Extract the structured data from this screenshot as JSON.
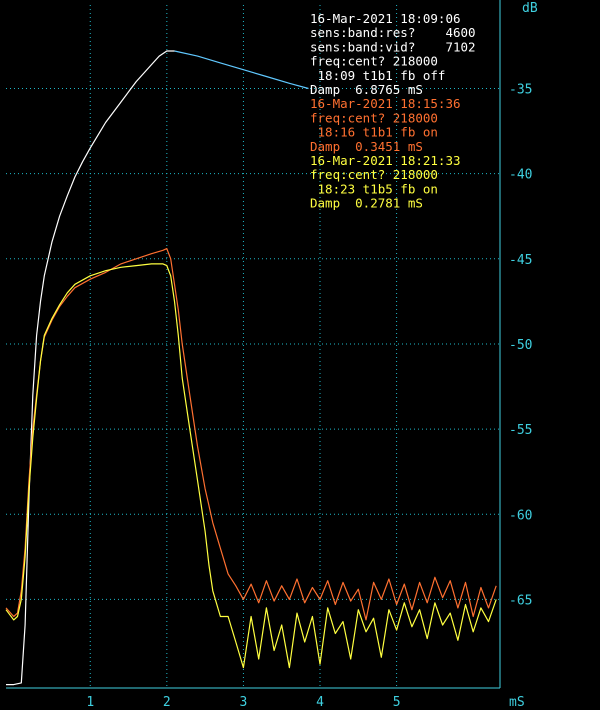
{
  "chart_data": {
    "type": "line",
    "ylabel": "dB",
    "xlabel": "mS",
    "xlim": [
      -0.1,
      6.35
    ],
    "ylim": [
      -70.2,
      -30.1
    ],
    "grid": true,
    "x_ticks": [
      1,
      2,
      3,
      4,
      5
    ],
    "y_ticks": [
      -35,
      -40,
      -45,
      -50,
      -55,
      -60,
      -65
    ],
    "annotations": [
      {
        "color": "#ffffff",
        "lines": [
          "16-Mar-2021 18:09:06",
          "sens:band:res?    4600",
          "sens:band:vid?    7102",
          "freq:cent? 218000",
          " 18:09 t1b1 fb off",
          "Damp  6.8765 mS"
        ]
      },
      {
        "color": "#ff7030",
        "lines": [
          "16-Mar-2021 18:15:36",
          "freq:cent? 218000",
          " 18:16 t1b1 fb on",
          "Damp  0.3451 mS"
        ]
      },
      {
        "color": "#ffff40",
        "lines": [
          "16-Mar-2021 18:21:33",
          "freq:cent? 218000",
          " 18:23 t1b5 fb on",
          "Damp  0.2781 mS"
        ]
      }
    ],
    "series": [
      {
        "color": "#ffffff",
        "x": [
          -0.1,
          0.0,
          0.1,
          0.15,
          0.2,
          0.25,
          0.3,
          0.35,
          0.4,
          0.5,
          0.6,
          0.7,
          0.8,
          0.9,
          1.0,
          1.2,
          1.4,
          1.6,
          1.8,
          1.9,
          2.0,
          2.1
        ],
        "y": [
          -70.0,
          -70.0,
          -69.9,
          -66.5,
          -59.0,
          -53.0,
          -49.5,
          -47.5,
          -46.0,
          -44.0,
          -42.5,
          -41.3,
          -40.2,
          -39.3,
          -38.5,
          -37.0,
          -35.8,
          -34.6,
          -33.6,
          -33.1,
          -32.8,
          -32.8
        ]
      },
      {
        "color": "#60c8ff",
        "x": [
          2.1,
          2.4,
          2.7,
          3.0,
          3.3,
          3.6,
          3.85
        ],
        "y": [
          -32.8,
          -33.1,
          -33.5,
          -33.9,
          -34.3,
          -34.7,
          -35.0
        ]
      },
      {
        "color": "#ff7030",
        "x": [
          -0.1,
          0.0,
          0.05,
          0.1,
          0.15,
          0.2,
          0.25,
          0.3,
          0.35,
          0.4,
          0.5,
          0.6,
          0.7,
          0.8,
          1.0,
          1.2,
          1.4,
          1.6,
          1.8,
          1.95,
          2.0,
          2.05,
          2.1,
          2.15,
          2.2,
          2.3,
          2.4,
          2.5,
          2.55,
          2.6,
          2.7,
          2.8,
          2.9,
          3.0,
          3.1,
          3.2,
          3.3,
          3.4,
          3.5,
          3.6,
          3.7,
          3.8,
          3.9,
          4.0,
          4.1,
          4.2,
          4.3,
          4.4,
          4.5,
          4.6,
          4.7,
          4.8,
          4.9,
          5.0,
          5.1,
          5.2,
          5.3,
          5.4,
          5.5,
          5.6,
          5.7,
          5.8,
          5.9,
          6.0,
          6.1,
          6.2,
          6.3
        ],
        "y": [
          -65.5,
          -66.0,
          -65.8,
          -64.5,
          -62.0,
          -58.0,
          -55.0,
          -53.0,
          -51.0,
          -49.6,
          -48.6,
          -47.8,
          -47.2,
          -46.7,
          -46.2,
          -45.8,
          -45.3,
          -45.0,
          -44.7,
          -44.5,
          -44.4,
          -45.0,
          -46.5,
          -48.0,
          -50.0,
          -53.0,
          -56.0,
          -58.5,
          -59.5,
          -60.5,
          -62.0,
          -63.5,
          -64.2,
          -65.0,
          -64.1,
          -65.2,
          -63.9,
          -65.1,
          -64.2,
          -65.0,
          -63.8,
          -65.2,
          -64.3,
          -65.0,
          -63.9,
          -65.3,
          -64.0,
          -65.1,
          -64.4,
          -66.2,
          -64.0,
          -65.0,
          -63.8,
          -65.3,
          -64.1,
          -65.6,
          -64.0,
          -65.2,
          -63.7,
          -64.9,
          -63.9,
          -65.5,
          -64.0,
          -66.0,
          -64.3,
          -65.5,
          -64.2
        ]
      },
      {
        "color": "#ffff40",
        "x": [
          -0.1,
          0.0,
          0.05,
          0.1,
          0.15,
          0.2,
          0.25,
          0.3,
          0.35,
          0.4,
          0.5,
          0.6,
          0.7,
          0.8,
          1.0,
          1.2,
          1.4,
          1.6,
          1.8,
          1.95,
          2.0,
          2.05,
          2.1,
          2.15,
          2.2,
          2.3,
          2.4,
          2.5,
          2.55,
          2.6,
          2.7,
          2.8,
          2.9,
          3.0,
          3.1,
          3.2,
          3.3,
          3.4,
          3.5,
          3.6,
          3.7,
          3.8,
          3.9,
          4.0,
          4.1,
          4.2,
          4.3,
          4.4,
          4.5,
          4.6,
          4.7,
          4.8,
          4.9,
          5.0,
          5.1,
          5.2,
          5.3,
          5.4,
          5.5,
          5.6,
          5.7,
          5.8,
          5.9,
          6.0,
          6.1,
          6.2,
          6.3
        ],
        "y": [
          -65.6,
          -66.2,
          -66.0,
          -65.0,
          -62.5,
          -58.5,
          -55.5,
          -53.2,
          -51.0,
          -49.5,
          -48.5,
          -47.7,
          -47.0,
          -46.5,
          -46.0,
          -45.7,
          -45.5,
          -45.4,
          -45.3,
          -45.3,
          -45.4,
          -46.0,
          -47.5,
          -49.5,
          -52.0,
          -55.0,
          -58.0,
          -61.0,
          -63.0,
          -64.5,
          -66.0,
          -66.0,
          -67.5,
          -69.0,
          -66.0,
          -68.5,
          -65.5,
          -68.0,
          -66.5,
          -69.0,
          -65.8,
          -67.5,
          -66.0,
          -68.8,
          -65.5,
          -67.0,
          -66.3,
          -68.5,
          -65.6,
          -66.9,
          -66.1,
          -68.4,
          -65.6,
          -66.8,
          -65.2,
          -66.6,
          -65.6,
          -67.3,
          -65.2,
          -66.5,
          -65.8,
          -67.4,
          -65.3,
          -66.9,
          -65.5,
          -66.3,
          -65.0
        ]
      }
    ]
  }
}
